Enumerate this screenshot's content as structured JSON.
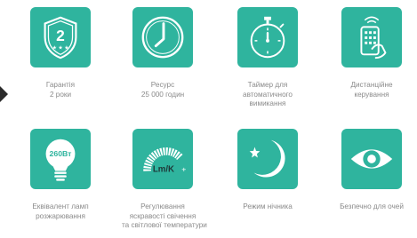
{
  "features": [
    {
      "name": "guarantee",
      "lines": [
        "Гарантія",
        "2 роки"
      ],
      "icon": "shield-2-icon",
      "badge": "2"
    },
    {
      "name": "resource",
      "lines": [
        "Ресурс",
        "25 000 годин"
      ],
      "icon": "clock-icon"
    },
    {
      "name": "timer",
      "lines": [
        "Таймер для",
        "автоматичного",
        "вимикання"
      ],
      "icon": "stopwatch-icon"
    },
    {
      "name": "remote",
      "lines": [
        "Дистанційне",
        "керування"
      ],
      "icon": "remote-control-icon"
    },
    {
      "name": "lamp-equivalent",
      "lines": [
        "Еквівалент ламп",
        "розжарювання"
      ],
      "icon": "light-bulb-icon",
      "badge": "260Вт"
    },
    {
      "name": "brightness",
      "lines": [
        "Регулювання",
        "яскравості свічення",
        "та світлової температури"
      ],
      "icon": "brightness-arc-icon",
      "badge": "Lm/K",
      "minus": "-",
      "plus": "+"
    },
    {
      "name": "night-mode",
      "lines": [
        "Режим нічника"
      ],
      "icon": "moon-star-icon"
    },
    {
      "name": "eye-safe",
      "lines": [
        "Безпечно для очей"
      ],
      "icon": "eye-icon"
    }
  ],
  "colors": {
    "accent": "#2fb49e",
    "text": "#8a8a8a",
    "arrow": "#2b2b2b"
  }
}
